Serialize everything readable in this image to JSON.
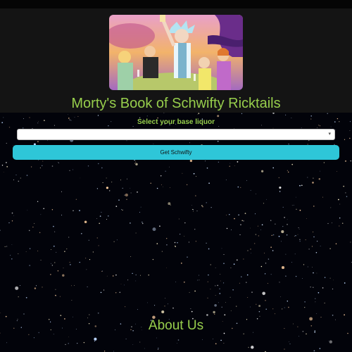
{
  "header": {
    "title": "Morty's Book of Schwifty Ricktails"
  },
  "form": {
    "select_label": "Select your base liquor",
    "select_value": "",
    "caret_glyph": "▾",
    "button_label": "Get Schwifty"
  },
  "footer": {
    "about_title": "About Us"
  },
  "colors": {
    "accent_green": "#97ce4c",
    "button_cyan": "#2ec6d8"
  }
}
